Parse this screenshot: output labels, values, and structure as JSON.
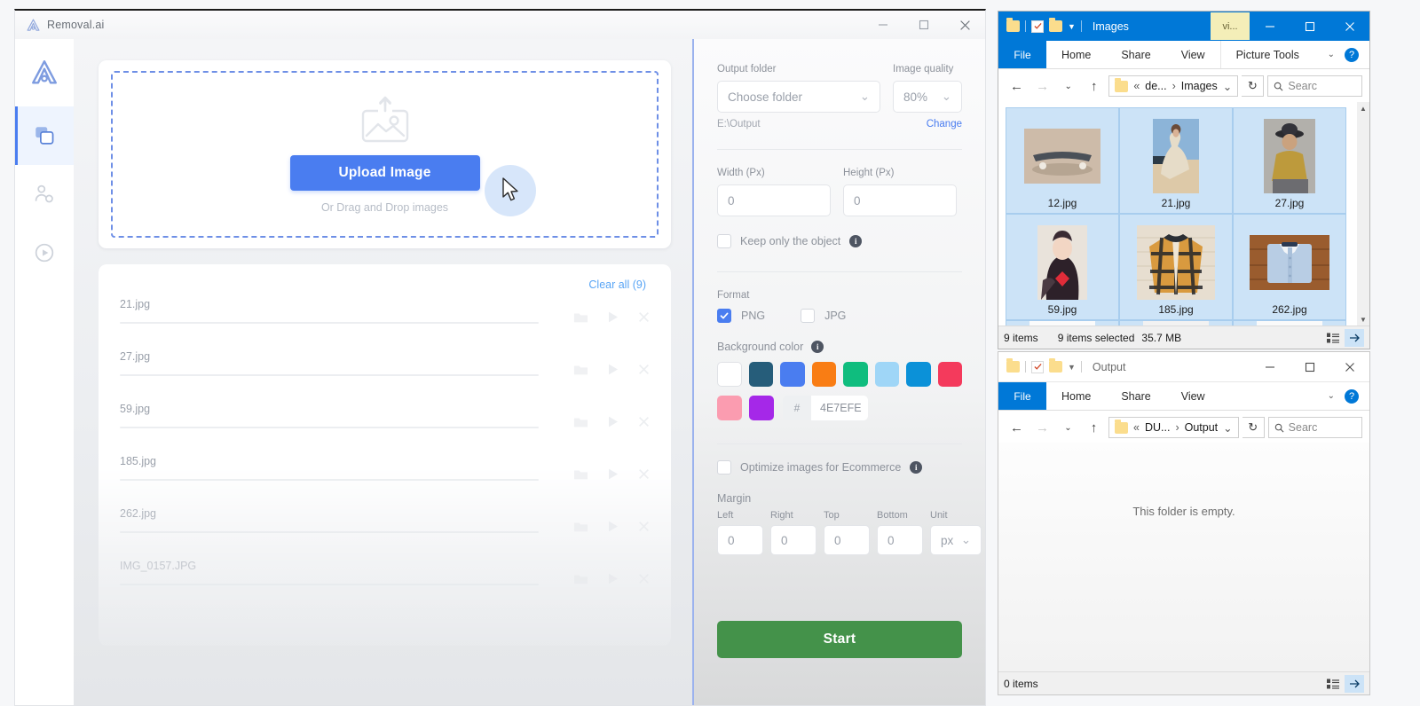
{
  "app": {
    "title": "Removal.ai",
    "window_controls": [
      "minimize",
      "maximize",
      "close"
    ],
    "rail": [
      {
        "name": "logo",
        "icon": "removal-logo-icon"
      },
      {
        "name": "batch",
        "icon": "layers-icon",
        "active": true
      },
      {
        "name": "person",
        "icon": "person-swap-icon",
        "active": false
      },
      {
        "name": "video",
        "icon": "play-circle-icon",
        "active": false
      }
    ],
    "dropzone": {
      "icon": "image-upload-icon",
      "button_label": "Upload Image",
      "hint": "Or Drag and Drop images"
    },
    "filelist": {
      "clear_all_label": "Clear all (9)",
      "rows": [
        {
          "name": "21.jpg"
        },
        {
          "name": "27.jpg"
        },
        {
          "name": "59.jpg"
        },
        {
          "name": "185.jpg"
        },
        {
          "name": "262.jpg"
        },
        {
          "name": "IMG_0157.JPG"
        }
      ],
      "row_actions": [
        "folder-icon",
        "play-icon",
        "close-icon"
      ]
    },
    "panel": {
      "output_folder_label": "Output folder",
      "output_folder_value": "Choose folder",
      "image_quality_label": "Image quality",
      "image_quality_value": "80%",
      "output_path": "E:\\Output",
      "change_label": "Change",
      "width_label": "Width (Px)",
      "width_value": "0",
      "height_label": "Height (Px)",
      "height_value": "0",
      "keep_object_label": "Keep only the object",
      "keep_object_checked": false,
      "format_label": "Format",
      "format_options": [
        {
          "label": "PNG",
          "checked": true
        },
        {
          "label": "JPG",
          "checked": false
        }
      ],
      "background_color_label": "Background color",
      "swatches_row1": [
        "#ffffff",
        "#265d7a",
        "#4a7df0",
        "#f97d14",
        "#0fbd7e",
        "#9fd6f7",
        "#0b91d8",
        "#f43a5c"
      ],
      "swatches_row2": [
        "#fb9cb0",
        "#a528e8"
      ],
      "hex_hash": "#",
      "hex_value": "4E7EFE",
      "optimize_label": "Optimize images for Ecommerce",
      "optimize_checked": false,
      "margin_label": "Margin",
      "margins": [
        {
          "label": "Left",
          "value": "0"
        },
        {
          "label": "Right",
          "value": "0"
        },
        {
          "label": "Top",
          "value": "0"
        },
        {
          "label": "Bottom",
          "value": "0"
        }
      ],
      "unit_label": "Unit",
      "unit_value": "px",
      "start_label": "Start"
    }
  },
  "explorer_images": {
    "title": "Images",
    "tab_label": "vi...",
    "ribbon": [
      "File",
      "Home",
      "Share",
      "View",
      "Picture Tools"
    ],
    "help_label": "?",
    "breadcrumb": [
      "de...",
      "Images"
    ],
    "breadcrumb_prefix": "«",
    "search_placeholder": "Searc",
    "thumbnails": [
      {
        "name": "12.jpg",
        "subject": "skateboard",
        "selected": true
      },
      {
        "name": "21.jpg",
        "subject": "woman-in-dress",
        "selected": true
      },
      {
        "name": "27.jpg",
        "subject": "child-with-hat",
        "selected": true
      },
      {
        "name": "59.jpg",
        "subject": "woman-portrait",
        "selected": true
      },
      {
        "name": "185.jpg",
        "subject": "plaid-jacket",
        "selected": true
      },
      {
        "name": "262.jpg",
        "subject": "blue-shirt",
        "selected": true
      }
    ],
    "status_count": "9 items",
    "status_selected": "9 items selected",
    "status_size": "35.7 MB",
    "window_controls": [
      "minimize",
      "maximize",
      "close"
    ]
  },
  "explorer_output": {
    "title": "Output",
    "ribbon": [
      "File",
      "Home",
      "Share",
      "View"
    ],
    "help_label": "?",
    "breadcrumb": [
      "DU...",
      "Output"
    ],
    "breadcrumb_prefix": "«",
    "search_placeholder": "Searc",
    "empty_message": "This folder is empty.",
    "status_count": "0 items",
    "window_controls": [
      "minimize",
      "maximize",
      "close"
    ]
  },
  "colors": {
    "accent_blue": "#4a7df0",
    "explorer_blue": "#0078d7",
    "start_green": "#44924a",
    "link_blue": "#59a5f5"
  }
}
